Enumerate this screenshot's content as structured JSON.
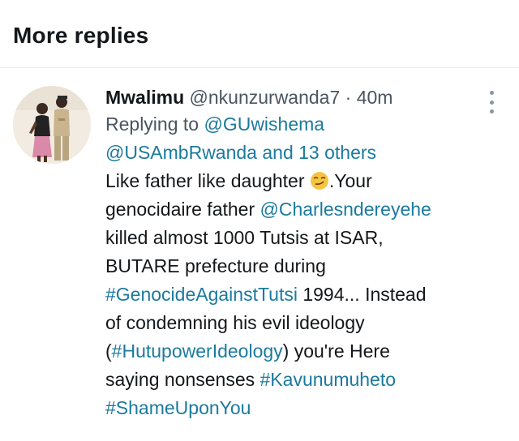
{
  "section": {
    "title": "More replies"
  },
  "tweet": {
    "author_name": "Mwalimu",
    "author_handle": "@nkunzurwanda7",
    "separator": "·",
    "timestamp": "40m",
    "avatar_icon": "user-photo-avatar",
    "more_icon": "more-vertical-icon",
    "replying_prefix": "Replying to",
    "replying_mention": "@GUwishema",
    "replying_mention_2": "@USAmbRwanda",
    "replying_others": "and 13 others",
    "text": {
      "l1_a": "Like father like daughter",
      "emoji": "smirking-face-emoji",
      "l1_b": ".Your",
      "l2_a": "genocidaire father",
      "l2_mention": "@Charlesndereyehe",
      "l3": "killed almost 1000 Tutsis at ISAR,",
      "l4": "BUTARE prefecture during",
      "l5_tag": "#GenocideAgainstTutsi",
      "l5_b": "1994... Instead",
      "l6": "of condemning his evil ideology",
      "l7_open": "(",
      "l7_tag": "#HutupowerIdeology",
      "l7_b": ") you're Here",
      "l8_a": "saying nonsenses",
      "l8_tag": "#Kavunumuheto",
      "l9_tag": "#ShameUponYou"
    }
  },
  "colors": {
    "link": "#1b7a9e",
    "secondary_text": "#4a5560",
    "primary_text": "#14171a",
    "divider": "#e6ecf0"
  }
}
